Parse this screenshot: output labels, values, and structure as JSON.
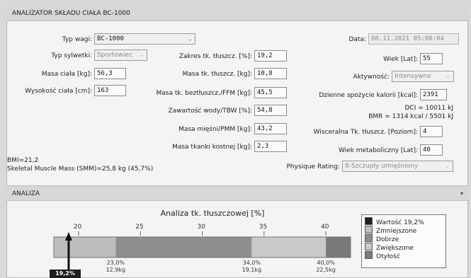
{
  "header": {
    "title": "ANALIZATOR SKŁADU CIAŁA BC-1000"
  },
  "form": {
    "typ_wagi": {
      "label": "Typ wagi:",
      "value": "BC-1000"
    },
    "typ_sylwetki": {
      "label": "Typ sylwetki:",
      "value": "Sportowiec"
    },
    "masa_ciala": {
      "label": "Masa ciała [kg]:",
      "value": "56,3"
    },
    "wysokosc_ciala": {
      "label": "Wysokość ciała [cm]:",
      "value": "163"
    },
    "zakres_tk": {
      "label": "Zakres tk. tłuszcz. [%]:",
      "value": "19,2"
    },
    "masa_tk": {
      "label": "Masa tk. tłuszcz. [kg]:",
      "value": "10,8"
    },
    "masa_beztl": {
      "label": "Masa tk. beztłuszcz./FFM [kg]:",
      "value": "45,5"
    },
    "woda": {
      "label": "Zawartość wody/TBW [%]:",
      "value": "54,8"
    },
    "miesnie": {
      "label": "Masa mięśni/PMM [kg]:",
      "value": "43,2"
    },
    "kosci": {
      "label": "Masa tkanki kostnej [kg]:",
      "value": "2,3"
    },
    "data": {
      "label": "Data:",
      "value": "08.11.2021 05:08:04"
    },
    "wiek": {
      "label": "Wiek [Lat]:",
      "value": "55"
    },
    "aktywnosc": {
      "label": "Aktywność:",
      "value": "Intensywne"
    },
    "kalorie": {
      "label": "Dzienne spożycie kalorii [kcal]:",
      "value": "2391"
    },
    "dci": "DCI = 10011 kJ",
    "bmr": "BMR = 1314 kcal / 5501 kJ",
    "wisceralna": {
      "label": "Wisceralna Tk. tłuszcz. [Poziom]:",
      "value": "4"
    },
    "wiek_metab": {
      "label": "Wiek metaboliczny [Lat]:",
      "value": "40"
    },
    "bmi": "BMI=21,2",
    "smm": "Skeletal Muscle Mass (SMM)=25,8 kg (45,7%)",
    "physique": {
      "label": "Physique Rating:",
      "value": "8-Szczupły umięśniony"
    }
  },
  "analiza": {
    "title": "ANALIZA",
    "collapse_icon": "chevron-down-icon"
  },
  "chart_data": {
    "type": "bar",
    "title": "Analiza tk. tłuszczowej [%]",
    "xlim": [
      18,
      42
    ],
    "ticks": [
      "20",
      "25",
      "30",
      "35",
      "40"
    ],
    "tick_values": [
      20,
      25,
      30,
      35,
      40
    ],
    "segments": [
      {
        "name": "Zmniejszone",
        "from": 18,
        "to": 23.0,
        "color": "#bdbdbd"
      },
      {
        "name": "Dobrze",
        "from": 23.0,
        "to": 34.0,
        "color": "#8e8e8e"
      },
      {
        "name": "Zwiększone",
        "from": 34.0,
        "to": 40.0,
        "color": "#c9c9c9"
      },
      {
        "name": "Otyłość",
        "from": 40.0,
        "to": 42,
        "color": "#7a7a7a"
      }
    ],
    "value": 19.2,
    "value_label": "19,2%",
    "boundaries": [
      {
        "value": 23.0,
        "pct": "23,0%",
        "kg": "12,9kg"
      },
      {
        "value": 34.0,
        "pct": "34,0%",
        "kg": "19,1kg"
      },
      {
        "value": 40.0,
        "pct": "40,0%",
        "kg": "22,5kg"
      }
    ],
    "legend": [
      {
        "label": "Wartość 19,2%",
        "color": "#1e1e1e"
      },
      {
        "label": "Zmniejszone",
        "color": "#bdbdbd"
      },
      {
        "label": "Dobrze",
        "color": "#8e8e8e"
      },
      {
        "label": "Zwiększone",
        "color": "#c9c9c9"
      },
      {
        "label": "Otyłość",
        "color": "#7a7a7a"
      }
    ]
  }
}
